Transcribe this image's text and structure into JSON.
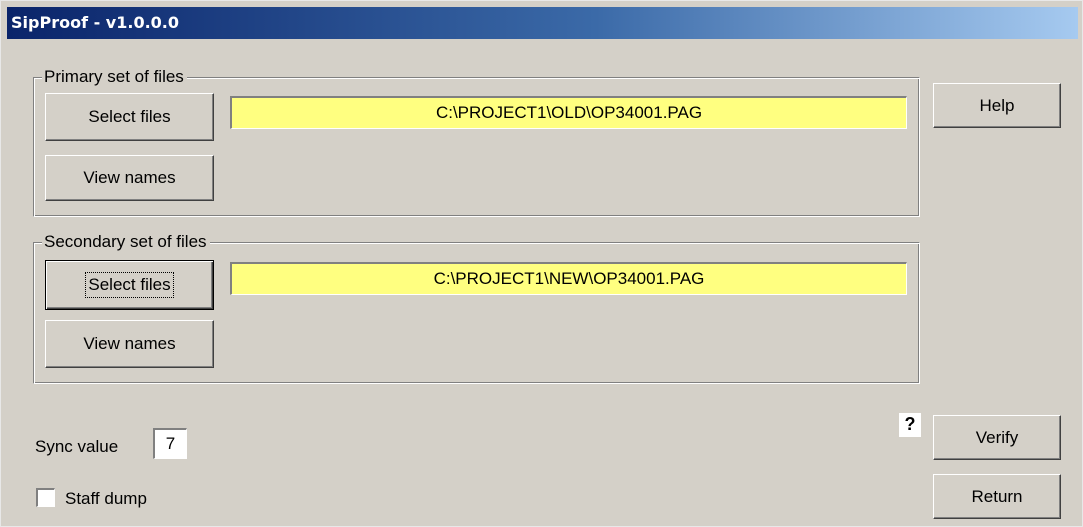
{
  "window": {
    "title": "SipProof - v1.0.0.0"
  },
  "primary": {
    "legend": "Primary set of files",
    "select_label": "Select files",
    "view_label": "View names",
    "path": "C:\\PROJECT1\\OLD\\OP34001.PAG"
  },
  "secondary": {
    "legend": "Secondary set of files",
    "select_label": "Select files",
    "view_label": "View names",
    "path": "C:\\PROJECT1\\NEW\\OP34001.PAG"
  },
  "side": {
    "help_label": "Help",
    "verify_label": "Verify",
    "return_label": "Return",
    "question_mark": "?"
  },
  "options": {
    "sync_label": "Sync value",
    "sync_value": "7",
    "staff_dump_label": "Staff dump",
    "staff_dump_checked": false
  },
  "colors": {
    "path_field_bg": "#ffff80",
    "title_gradient_start": "#0a246a",
    "title_gradient_end": "#a6caf0"
  }
}
